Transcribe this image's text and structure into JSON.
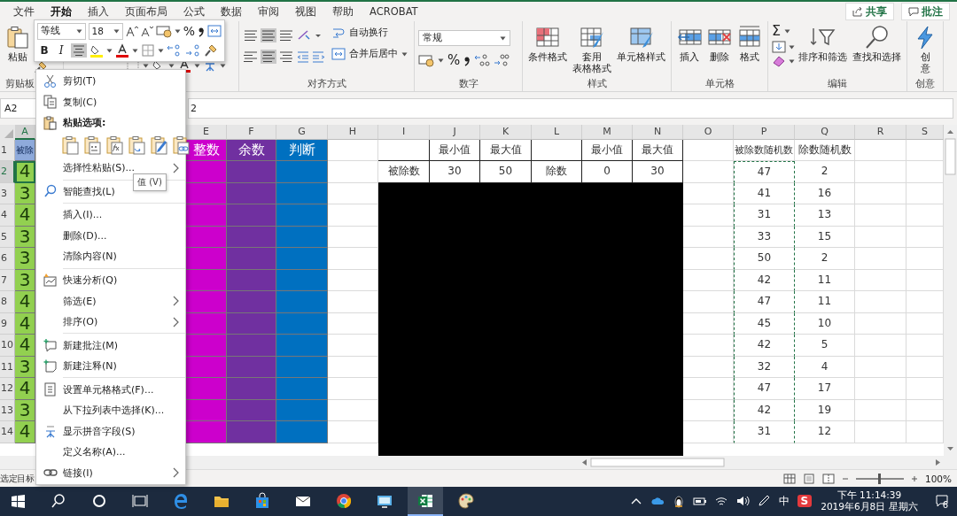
{
  "tabs": [
    {
      "label": "文件",
      "selected": false
    },
    {
      "label": "开始",
      "selected": true
    },
    {
      "label": "插入",
      "selected": false
    },
    {
      "label": "页面布局",
      "selected": false
    },
    {
      "label": "公式",
      "selected": false
    },
    {
      "label": "数据",
      "selected": false
    },
    {
      "label": "审阅",
      "selected": false
    },
    {
      "label": "视图",
      "selected": false
    },
    {
      "label": "帮助",
      "selected": false
    },
    {
      "label": "ACROBAT",
      "selected": false
    }
  ],
  "share_button": "共享",
  "comments_button": "批注",
  "ribbon": {
    "groups": [
      {
        "kind": "clipboard",
        "label": "剪贴板",
        "items": [
          {
            "kind": "large",
            "lines": [
              "粘贴"
            ]
          }
        ]
      },
      {
        "kind": "font"
      },
      {
        "kind": "alignment",
        "label": "对齐方式",
        "items": [
          {
            "kind": "small",
            "label": "自动换行"
          },
          {
            "kind": "small",
            "label": "合并后居中"
          }
        ]
      },
      {
        "kind": "number",
        "label": "数字",
        "format": "常规",
        "percent": "%"
      },
      {
        "kind": "buttons",
        "label": "样式",
        "items": [
          {
            "kind": "large",
            "lines": [
              "条件格式"
            ]
          },
          {
            "kind": "large",
            "lines": [
              "套用",
              "表格格式"
            ]
          },
          {
            "kind": "large",
            "lines": [
              "单元格样式"
            ]
          }
        ]
      },
      {
        "kind": "buttons",
        "label": "单元格",
        "items": [
          {
            "kind": "large",
            "lines": [
              "插入"
            ]
          },
          {
            "kind": "large",
            "lines": [
              "删除"
            ]
          },
          {
            "kind": "large",
            "lines": [
              "格式"
            ]
          }
        ]
      },
      {
        "kind": "editing",
        "label": "编辑",
        "sum": "Σ",
        "items": [
          {
            "kind": "large",
            "lines": [
              "排序和筛选"
            ]
          },
          {
            "kind": "large",
            "lines": [
              "查找和选择"
            ]
          }
        ]
      },
      {
        "kind": "buttons",
        "label": "创意",
        "items": [
          {
            "kind": "large",
            "lines": [
              "创",
              "意"
            ]
          }
        ]
      }
    ]
  },
  "name_box": "A2",
  "formula": "2",
  "grid": {
    "columns": [
      {
        "label": "A",
        "selected": true,
        "copied": false,
        "color": "#92d050",
        "header_cell": {
          "color": "#8eaadb"
        }
      },
      {
        "label": "E",
        "selected": false,
        "copied": false,
        "color": "#cc00cc"
      },
      {
        "label": "F",
        "selected": false,
        "copied": false,
        "color": "#7030a0"
      },
      {
        "label": "G",
        "selected": false,
        "copied": false,
        "color": "#0070c0"
      },
      {
        "label": "H",
        "selected": false,
        "copied": false
      },
      {
        "label": "I",
        "selected": false,
        "copied": false
      },
      {
        "label": "J",
        "selected": false,
        "copied": false
      },
      {
        "label": "K",
        "selected": false,
        "copied": false
      },
      {
        "label": "L",
        "selected": false,
        "copied": false
      },
      {
        "label": "M",
        "selected": false,
        "copied": false
      },
      {
        "label": "N",
        "selected": false,
        "copied": false
      },
      {
        "label": "O",
        "selected": false,
        "copied": false
      },
      {
        "label": "P",
        "selected": false,
        "copied": true
      },
      {
        "label": "Q",
        "selected": false,
        "copied": false
      },
      {
        "label": "R",
        "selected": false,
        "copied": false
      },
      {
        "label": "S",
        "selected": false,
        "copied": false
      }
    ],
    "rows": [
      {
        "label": "1",
        "selected": false,
        "cells": [
          "被除",
          "整数",
          "余数",
          "判断",
          "",
          "",
          "最小值",
          "最大值",
          "",
          "最小值",
          "最大值",
          "",
          "被除数随机数",
          "除数随机数",
          "",
          ""
        ]
      },
      {
        "label": "2",
        "selected": true,
        "cells": [
          "4",
          "",
          "",
          "",
          "",
          "被除数",
          "30",
          "50",
          "除数",
          "0",
          "30",
          "",
          "47",
          "2",
          "",
          ""
        ]
      },
      {
        "label": "3",
        "selected": false,
        "cells": [
          "3",
          "",
          "",
          "",
          "",
          "",
          "",
          "",
          "",
          "",
          "",
          "",
          "41",
          "16",
          "",
          ""
        ]
      },
      {
        "label": "4",
        "selected": false,
        "cells": [
          "4",
          "",
          "",
          "",
          "",
          "",
          "",
          "",
          "",
          "",
          "",
          "",
          "31",
          "13",
          "",
          ""
        ]
      },
      {
        "label": "5",
        "selected": false,
        "cells": [
          "3",
          "",
          "",
          "",
          "",
          "",
          "",
          "",
          "",
          "",
          "",
          "",
          "33",
          "15",
          "",
          ""
        ]
      },
      {
        "label": "6",
        "selected": false,
        "cells": [
          "3",
          "",
          "",
          "",
          "",
          "",
          "",
          "",
          "",
          "",
          "",
          "",
          "50",
          "2",
          "",
          ""
        ]
      },
      {
        "label": "7",
        "selected": false,
        "cells": [
          "3",
          "",
          "",
          "",
          "",
          "",
          "",
          "",
          "",
          "",
          "",
          "",
          "42",
          "11",
          "",
          ""
        ]
      },
      {
        "label": "8",
        "selected": false,
        "cells": [
          "4",
          "",
          "",
          "",
          "",
          "",
          "",
          "",
          "",
          "",
          "",
          "",
          "47",
          "11",
          "",
          ""
        ]
      },
      {
        "label": "9",
        "selected": false,
        "cells": [
          "4",
          "",
          "",
          "",
          "",
          "",
          "",
          "",
          "",
          "",
          "",
          "",
          "45",
          "10",
          "",
          ""
        ]
      },
      {
        "label": "10",
        "selected": false,
        "cells": [
          "4",
          "",
          "",
          "",
          "",
          "",
          "",
          "",
          "",
          "",
          "",
          "",
          "42",
          "5",
          "",
          ""
        ]
      },
      {
        "label": "11",
        "selected": false,
        "cells": [
          "3",
          "",
          "",
          "",
          "",
          "",
          "",
          "",
          "",
          "",
          "",
          "",
          "32",
          "4",
          "",
          ""
        ]
      },
      {
        "label": "12",
        "selected": false,
        "cells": [
          "4",
          "",
          "",
          "",
          "",
          "",
          "",
          "",
          "",
          "",
          "",
          "",
          "47",
          "17",
          "",
          ""
        ]
      },
      {
        "label": "13",
        "selected": false,
        "cells": [
          "3",
          "",
          "",
          "",
          "",
          "",
          "",
          "",
          "",
          "",
          "",
          "",
          "42",
          "19",
          "",
          ""
        ]
      },
      {
        "label": "14",
        "selected": false,
        "cells": [
          "4",
          "",
          "",
          "",
          "",
          "",
          "",
          "",
          "",
          "",
          "",
          "",
          "31",
          "12",
          "",
          ""
        ]
      }
    ]
  },
  "mini_toolbar": {
    "font": "等线",
    "size": "18",
    "percent": "%",
    "bold": "B",
    "italic": "I"
  },
  "context_menu": {
    "items": [
      {
        "kind": "icon_item",
        "label": "剪切(T)",
        "submenu": false
      },
      {
        "kind": "icon_item",
        "label": "复制(C)",
        "submenu": false
      },
      {
        "kind": "icon_heading",
        "label": "粘贴选项:"
      },
      {
        "kind": "paste_options"
      },
      {
        "kind": "item",
        "label": "选择性粘贴(S)...",
        "submenu": true
      },
      {
        "kind": "separator"
      },
      {
        "kind": "icon_item",
        "label": "智能查找(L)",
        "submenu": false
      },
      {
        "kind": "separator"
      },
      {
        "kind": "item",
        "label": "插入(I)...",
        "submenu": false
      },
      {
        "kind": "item",
        "label": "删除(D)...",
        "submenu": false
      },
      {
        "kind": "item",
        "label": "清除内容(N)",
        "submenu": false
      },
      {
        "kind": "separator"
      },
      {
        "kind": "icon_item",
        "label": "快速分析(Q)",
        "submenu": false
      },
      {
        "kind": "item",
        "label": "筛选(E)",
        "submenu": true
      },
      {
        "kind": "item",
        "label": "排序(O)",
        "submenu": true
      },
      {
        "kind": "separator"
      },
      {
        "kind": "icon_item",
        "label": "新建批注(M)",
        "submenu": false
      },
      {
        "kind": "icon_item",
        "label": "新建注释(N)",
        "submenu": false
      },
      {
        "kind": "separator"
      },
      {
        "kind": "icon_item",
        "label": "设置单元格格式(F)...",
        "submenu": false
      },
      {
        "kind": "item",
        "label": "从下拉列表中选择(K)...",
        "submenu": false
      },
      {
        "kind": "icon_item",
        "label": "显示拼音字段(S)",
        "submenu": false
      },
      {
        "kind": "item",
        "label": "定义名称(A)...",
        "submenu": false
      },
      {
        "kind": "icon_item",
        "label": "链接(I)",
        "submenu": true
      }
    ]
  },
  "tooltip": "值 (V)",
  "status_bar": {
    "text": "选定目标",
    "zoom": "100%",
    "zoom_slider": {
      "level": 0.5
    }
  },
  "taskbar": {
    "apps": [
      {
        "active": false
      },
      {
        "active": false
      },
      {
        "active": false
      },
      {
        "active": false
      },
      {
        "active": false
      },
      {
        "active": false
      },
      {
        "active": false
      },
      {
        "active": false
      },
      {
        "active": false
      },
      {
        "active": false
      },
      {
        "active": true
      },
      {
        "active": false
      }
    ],
    "ime": "中",
    "ime_app": "S",
    "time": "下午 11:14:39",
    "date": "2019年6月8日 星期六",
    "notifications": "6"
  }
}
